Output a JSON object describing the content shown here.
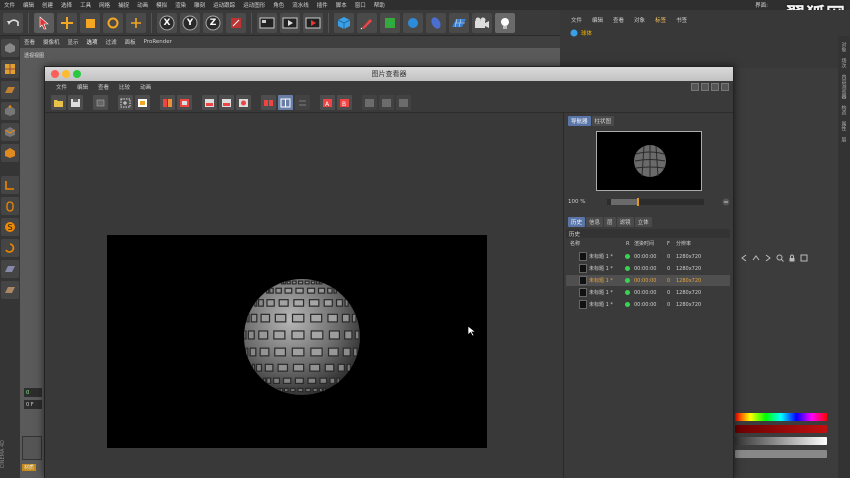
{
  "menubar": {
    "items": [
      "文件",
      "编辑",
      "创建",
      "选择",
      "工具",
      "网格",
      "捕捉",
      "动画",
      "模拟",
      "渲染",
      "雕刻",
      "运动跟踪",
      "运动图形",
      "角色",
      "流水线",
      "插件",
      "脚本",
      "窗口",
      "帮助"
    ],
    "layout_label": "界面:",
    "watermark": "翼狐网"
  },
  "toolbar": {
    "icons": [
      "undo-icon",
      "select-arrow-icon",
      "move-icon",
      "scale-icon",
      "rotate-icon",
      "move-plus-icon",
      "x-axis-icon",
      "y-axis-icon",
      "z-axis-icon",
      "coordinate-icon",
      "render-region-icon",
      "render-view-icon",
      "render-picture-icon",
      "cube-icon",
      "pen-icon",
      "subdivision-icon",
      "deformer-icon",
      "environment-icon",
      "floor-icon",
      "camera-icon",
      "light-icon"
    ],
    "axes": [
      "X",
      "Y",
      "Z"
    ]
  },
  "viewport": {
    "menu": [
      "查看",
      "摄像机",
      "显示",
      "选项",
      "过滤",
      "面板",
      "ProRender"
    ],
    "label": "透视视图"
  },
  "object_manager": {
    "menu": [
      "文件",
      "编辑",
      "查看",
      "对象",
      "标签",
      "书签"
    ],
    "object_name": "球体"
  },
  "right_strip": {
    "tabs": [
      "对象",
      "场次",
      "内容浏览器",
      "构造",
      "属性",
      "层"
    ]
  },
  "timeline": {
    "frame_top": "0",
    "frame_bottom": "0 F"
  },
  "material": {
    "label": "材质",
    "brand": "CINEMA 4D"
  },
  "picture_viewer": {
    "title": "图片查看器",
    "menu": [
      "文件",
      "编辑",
      "查看",
      "比较",
      "动画"
    ],
    "navigator_tabs": [
      "导航器",
      "柱状图"
    ],
    "zoom": "100 %",
    "zoom_level": 0.26,
    "history_tabs": [
      "历史",
      "信息",
      "层",
      "滤镜",
      "立体"
    ],
    "history_title": "历史",
    "columns": {
      "name": "名称",
      "r": "R",
      "render_time": "渲染时间",
      "f": "F",
      "resolution": "分辨率"
    },
    "rows": [
      {
        "name": "未标题 1 *",
        "time": "00:00:00",
        "f": "0",
        "res": "1280x720",
        "selected": false
      },
      {
        "name": "未标题 1 *",
        "time": "00:00:00",
        "f": "0",
        "res": "1280x720",
        "selected": false
      },
      {
        "name": "未标题 1 *",
        "time": "00:00:00",
        "f": "0",
        "res": "1280x720",
        "selected": true
      },
      {
        "name": "未标题 1 *",
        "time": "00:00:00",
        "f": "0",
        "res": "1280x720",
        "selected": false
      },
      {
        "name": "未标题 1 *",
        "time": "00:00:00",
        "f": "0",
        "res": "1280x720",
        "selected": false
      }
    ]
  },
  "colors": {
    "accent": "#e49a1a",
    "selection_blue": "#5a75a8",
    "status_green": "#39d353",
    "object_yellow": "#f5b800"
  }
}
